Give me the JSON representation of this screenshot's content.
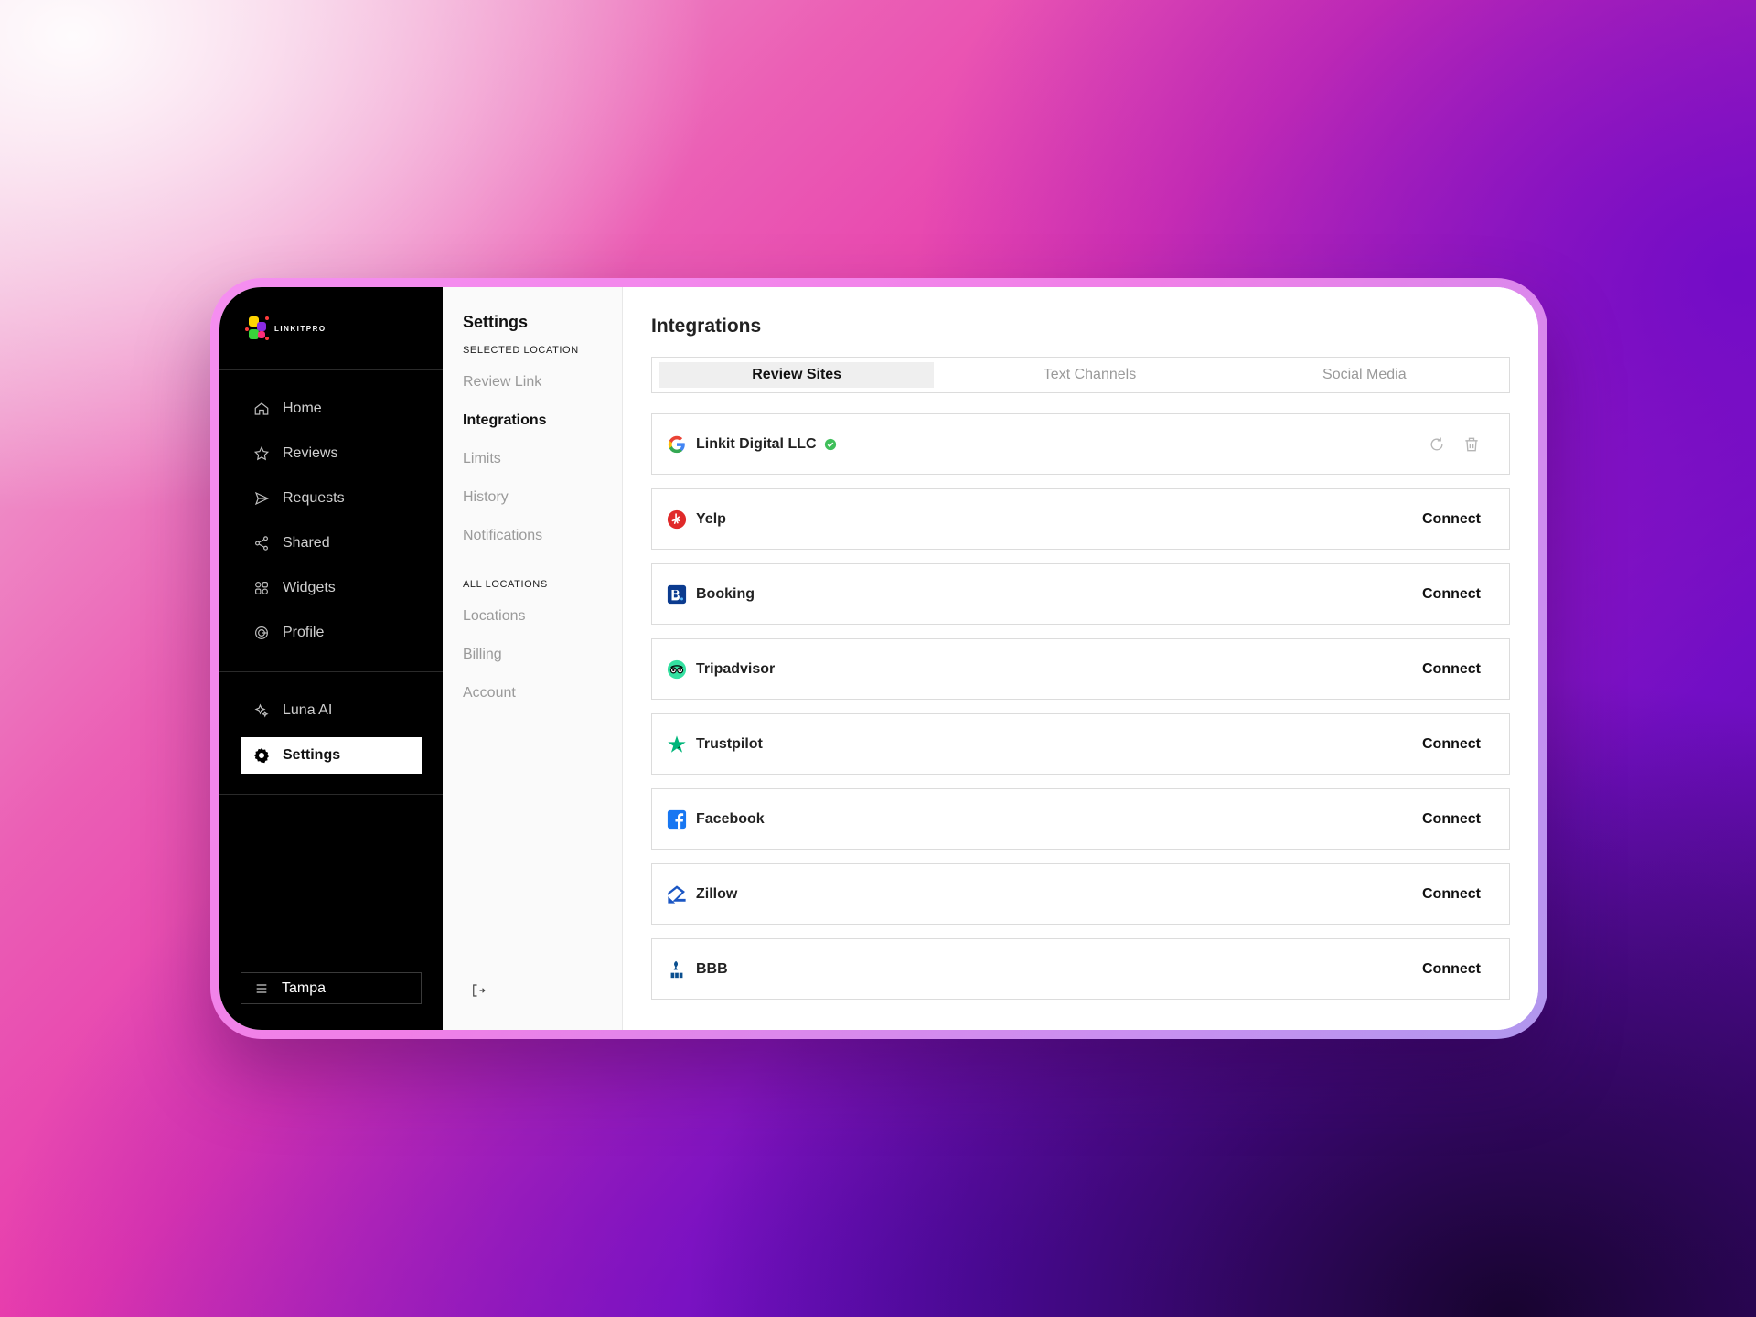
{
  "brand": {
    "logo_text": "LINKITPRO"
  },
  "sidebar": {
    "primary": [
      {
        "label": "Home",
        "icon": "home-icon"
      },
      {
        "label": "Reviews",
        "icon": "star-icon"
      },
      {
        "label": "Requests",
        "icon": "send-icon"
      },
      {
        "label": "Shared",
        "icon": "share-icon"
      },
      {
        "label": "Widgets",
        "icon": "widgets-icon"
      },
      {
        "label": "Profile",
        "icon": "profile-icon"
      }
    ],
    "secondary": [
      {
        "label": "Luna AI",
        "icon": "sparkle-icon"
      },
      {
        "label": "Settings",
        "icon": "gear-icon",
        "active": true
      }
    ],
    "location": {
      "label": "Tampa",
      "icon": "menu-icon"
    }
  },
  "settings_nav": {
    "title": "Settings",
    "selected_heading": "SELECTED LOCATION",
    "selected_items": [
      "Review Link",
      "Integrations",
      "Limits",
      "History",
      "Notifications"
    ],
    "all_heading": "ALL LOCATIONS",
    "all_items": [
      "Locations",
      "Billing",
      "Account"
    ]
  },
  "main": {
    "title": "Integrations",
    "tabs": [
      "Review Sites",
      "Text Channels",
      "Social Media"
    ],
    "integrations": [
      {
        "name": "Linkit Digital LLC",
        "icon": "google-icon",
        "connected": true
      },
      {
        "name": "Yelp",
        "icon": "yelp-icon",
        "action": "Connect"
      },
      {
        "name": "Booking",
        "icon": "booking-icon",
        "action": "Connect"
      },
      {
        "name": "Tripadvisor",
        "icon": "tripadvisor-icon",
        "action": "Connect"
      },
      {
        "name": "Trustpilot",
        "icon": "trustpilot-icon",
        "action": "Connect"
      },
      {
        "name": "Facebook",
        "icon": "facebook-icon",
        "action": "Connect"
      },
      {
        "name": "Zillow",
        "icon": "zillow-icon",
        "action": "Connect"
      },
      {
        "name": "BBB",
        "icon": "bbb-icon",
        "action": "Connect"
      }
    ]
  },
  "colors": {
    "sidebar_bg": "#000000",
    "verified_green": "#3fbf5a",
    "yelp_red": "#e02a2a",
    "booking_blue": "#0b3b8f",
    "tripadvisor_green": "#34e0a1",
    "trustpilot_green": "#00b67a",
    "facebook_blue": "#1877f2",
    "zillow_blue": "#1a56c4"
  }
}
